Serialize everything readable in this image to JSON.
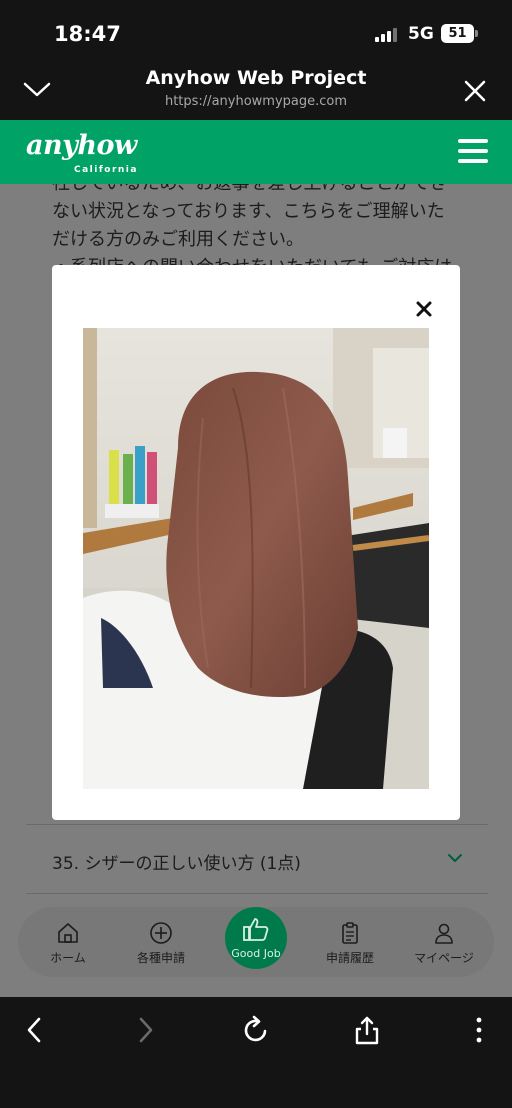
{
  "status_bar": {
    "time": "18:47",
    "network": "5G",
    "battery": "51"
  },
  "browser": {
    "title": "Anyhow Web Project",
    "url": "https://anyhowmypage.com"
  },
  "site_nav": {
    "logo_text": "anyhow",
    "logo_subtext": "California"
  },
  "notice_lines": [
    "社しているため、お返事を差し上げることができ",
    "ない状況となっております、こちらをご理解いた",
    "だける方のみご利用ください。",
    "・系列店への問い合わせをいただいても ご対応は"
  ],
  "item": {
    "label": "35. シザーの正しい使い方 (1点)"
  },
  "tabs": {
    "home": "ホーム",
    "apply": "各種申請",
    "good_job": "Good Job",
    "history": "申請履歴",
    "mypage": "マイページ"
  },
  "colors": {
    "brand_green": "#00a266",
    "good_job_green": "#007a4b"
  },
  "icons": {
    "collapse": "chevron-down-icon",
    "close": "close-icon",
    "menu": "hamburger-icon",
    "home": "home-icon",
    "apply": "plus-circle-icon",
    "good_job": "thumbs-up-icon",
    "history": "clipboard-icon",
    "mypage": "person-icon",
    "back": "back-icon",
    "forward": "forward-icon",
    "reload": "reload-icon",
    "share": "share-icon",
    "more": "more-icon"
  }
}
